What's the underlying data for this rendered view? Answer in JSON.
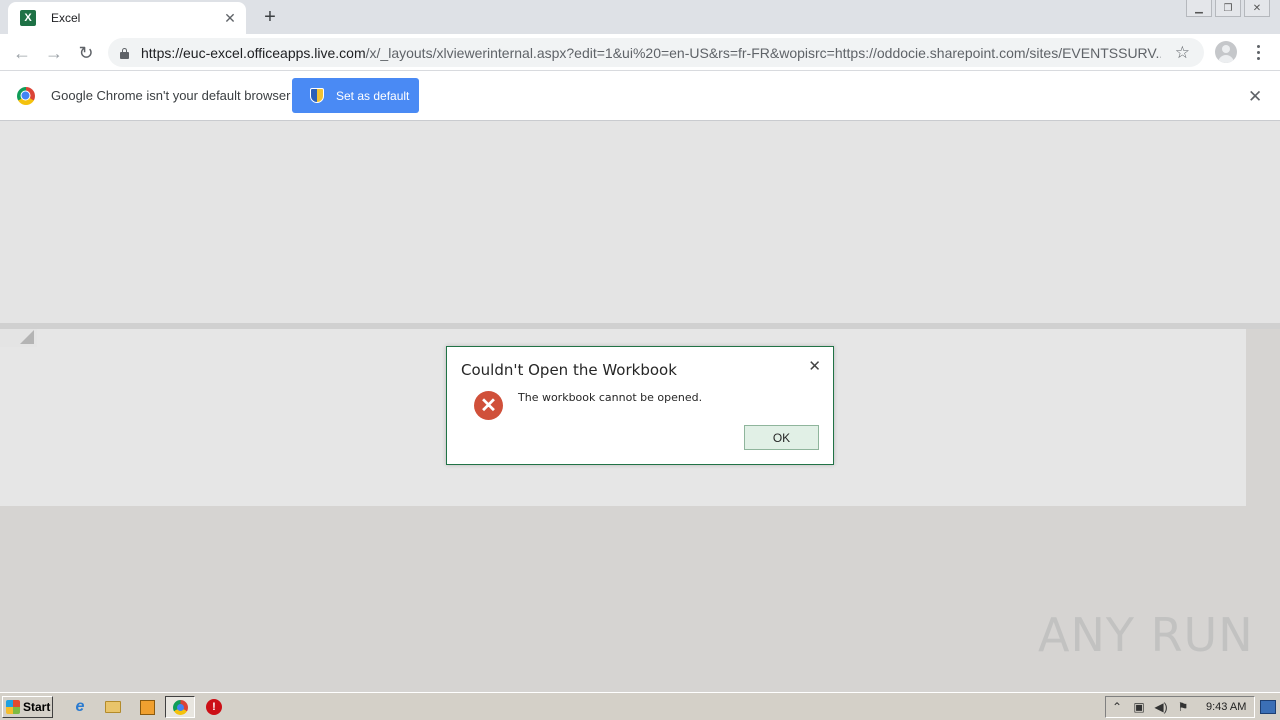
{
  "browser": {
    "tab_title": "Excel",
    "tab_favicon_letter": "X",
    "url_host": "https://euc-excel.officeapps.live.com",
    "url_path": "/x/_layouts/xlviewerinternal.aspx?edit=1&ui%20=en-US&rs=fr-FR&wopisrc=https://oddocie.sharepoint.com/sites/EVENTSSURV..."
  },
  "infobar": {
    "message": "Google Chrome isn't your default browser",
    "button_label": "Set as default"
  },
  "dialog": {
    "title": "Couldn't Open the Workbook",
    "message": "The workbook cannot be opened.",
    "ok_label": "OK",
    "border_color": "#217346",
    "error_color": "#d0503a"
  },
  "watermark": "ANY RUN",
  "taskbar": {
    "start_label": "Start",
    "clock": "9:43 AM"
  },
  "colors": {
    "accent_button": "#4a8af4",
    "excel_green": "#1e7145"
  }
}
